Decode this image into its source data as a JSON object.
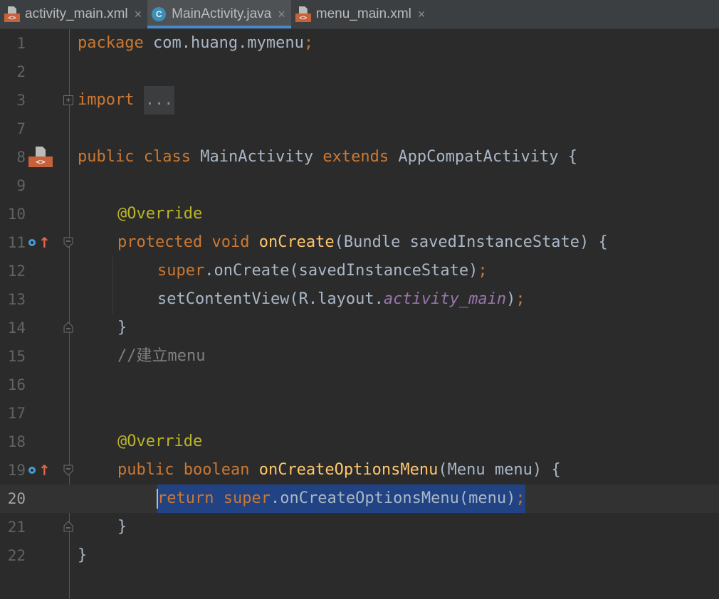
{
  "tabs": [
    {
      "label": "activity_main.xml",
      "icon": "xml-layout-icon",
      "active": false
    },
    {
      "label": "MainActivity.java",
      "icon": "java-class-icon",
      "active": true
    },
    {
      "label": "menu_main.xml",
      "icon": "xml-layout-icon",
      "active": false
    }
  ],
  "tab_close_glyph": "×",
  "class_icon_letter": "C",
  "xml_icon_glyph": "<>",
  "lines": [
    {
      "n": "1"
    },
    {
      "n": "2"
    },
    {
      "n": "3"
    },
    {
      "n": "7"
    },
    {
      "n": "8"
    },
    {
      "n": "9"
    },
    {
      "n": "10"
    },
    {
      "n": "11"
    },
    {
      "n": "12"
    },
    {
      "n": "13"
    },
    {
      "n": "14"
    },
    {
      "n": "15"
    },
    {
      "n": "16"
    },
    {
      "n": "17"
    },
    {
      "n": "18"
    },
    {
      "n": "19"
    },
    {
      "n": "20"
    },
    {
      "n": "21"
    },
    {
      "n": "22"
    }
  ],
  "code": {
    "l1": {
      "kw": "package",
      "rest": " com.huang.mymenu",
      "semi": ";"
    },
    "l3": {
      "kw": "import",
      "folded": "..."
    },
    "l8": {
      "kw1": "public",
      "kw2": "class",
      "name": " MainActivity ",
      "kw3": "extends",
      "rest": " AppCompatActivity {"
    },
    "l10": {
      "annotation": "@Override"
    },
    "l11": {
      "kw1": "protected",
      "kw2": "void",
      "fn": "onCreate",
      "rest": "(Bundle savedInstanceState) {"
    },
    "l12": {
      "kw": "super",
      "rest": ".onCreate(savedInstanceState)",
      "semi": ";"
    },
    "l13": {
      "pre": "setContentView(R.layout.",
      "field": "activity_main",
      "post": ")",
      "semi": ";"
    },
    "l14": {
      "text": "}"
    },
    "l15": {
      "comment": "//建立menu"
    },
    "l18": {
      "annotation": "@Override"
    },
    "l19": {
      "kw1": "public",
      "kw2": "boolean",
      "fn": "onCreateOptionsMenu",
      "rest": "(Menu menu) {"
    },
    "l20": {
      "kw1": "return",
      "kw2": "super",
      "rest": ".onCreateOptionsMenu(menu)",
      "semi": ";"
    },
    "l21": {
      "text": "}"
    },
    "l22": {
      "text": "}"
    }
  },
  "current_line": "20",
  "colors": {
    "background": "#2b2b2b",
    "keyword": "#cc7832",
    "function": "#ffc66d",
    "annotation": "#bbb529",
    "comment": "#808080",
    "field": "#9876aa",
    "selection": "#214283",
    "tab_underline": "#4a88c7"
  }
}
